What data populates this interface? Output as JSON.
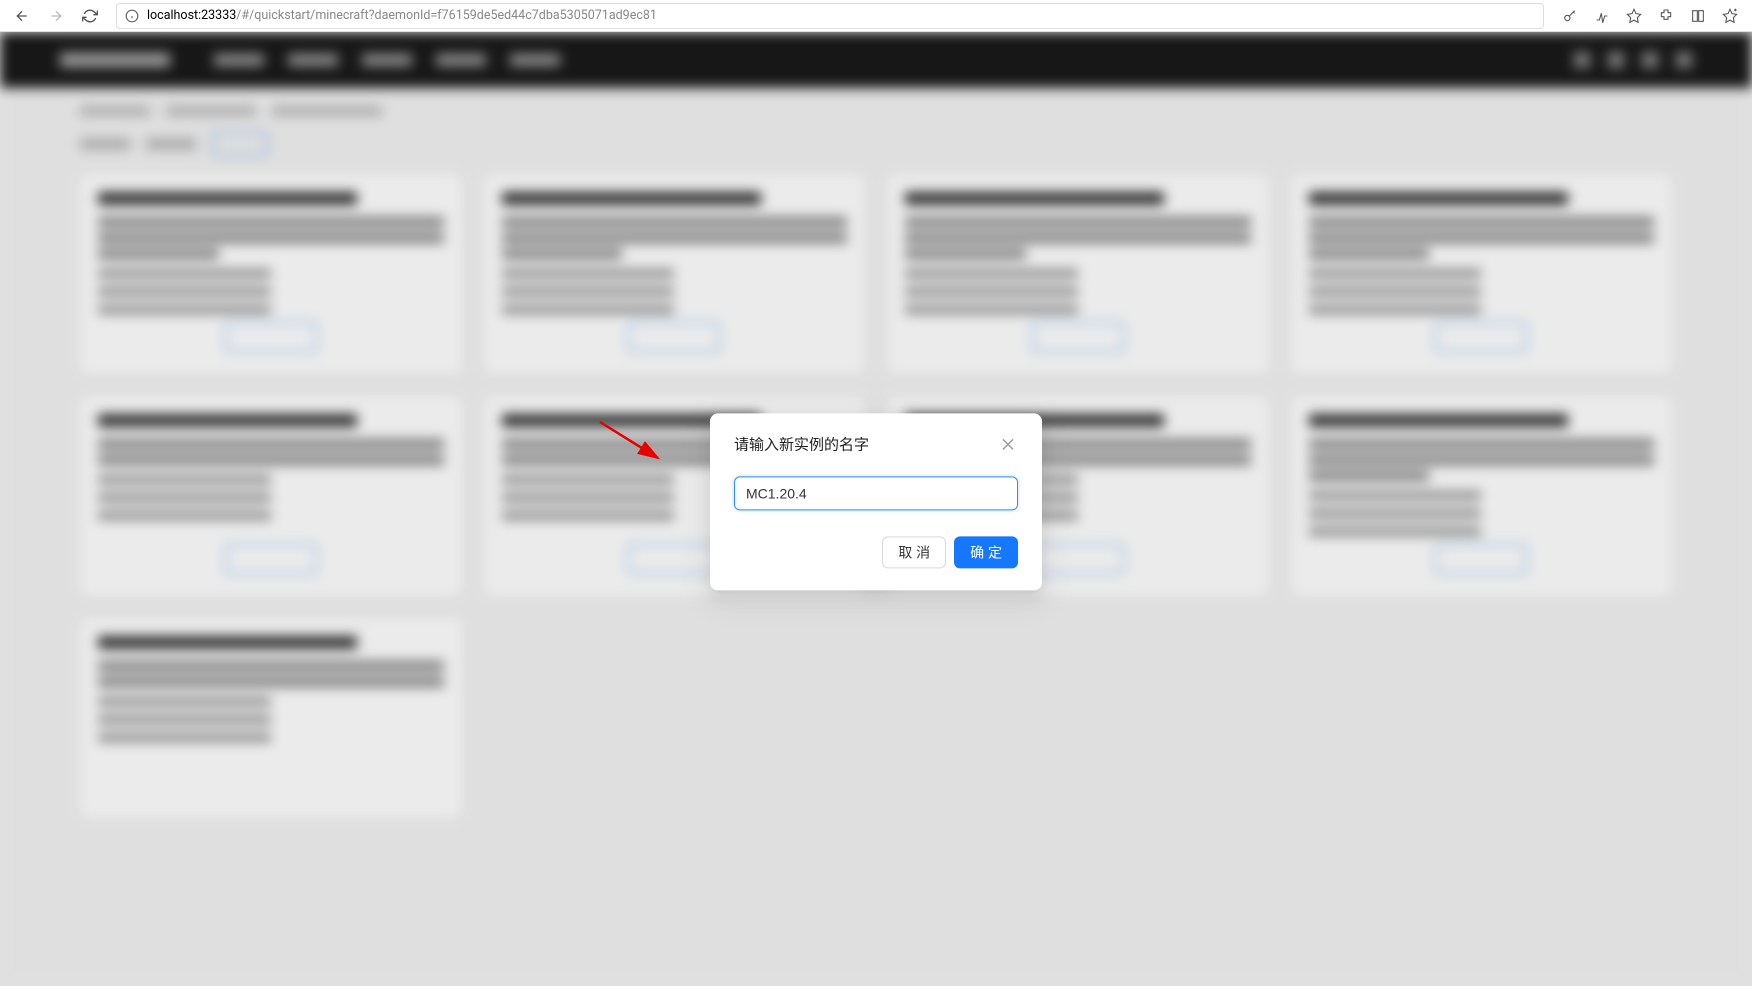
{
  "browser": {
    "url_host": "localhost",
    "url_port": ":23333",
    "url_path": "/#/quickstart/minecraft?daemonId=f76159de5ed44c7dba5305071ad9ec81"
  },
  "modal": {
    "title": "请输入新实例的名字",
    "input_value": "MC1.20.4",
    "cancel_label": "取 消",
    "confirm_label": "确 定"
  }
}
